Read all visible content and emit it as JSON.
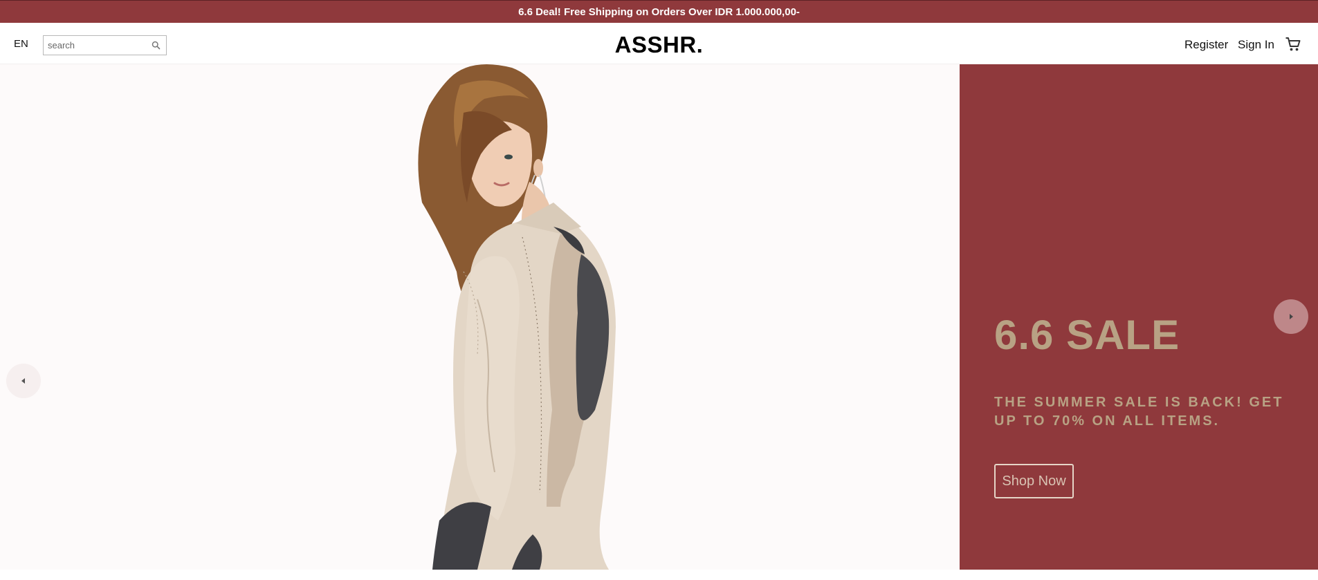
{
  "promo": {
    "text": "6.6 Deal! Free Shipping on Orders Over IDR 1.000.000,00-"
  },
  "header": {
    "language": "EN",
    "search_placeholder": "search",
    "logo": "ASSHR.",
    "register": "Register",
    "sign_in": "Sign In",
    "search_icon": "search-icon",
    "cart_icon": "cart-icon"
  },
  "hero": {
    "title": "6.6 SALE",
    "subtitle": "THE SUMMER SALE IS BACK! GET UP TO 70% ON ALL ITEMS.",
    "cta": "Shop Now",
    "prev_icon": "chevron-left-icon",
    "next_icon": "chevron-right-icon"
  },
  "colors": {
    "brand": "#8f393c",
    "sale_text": "#b8a284",
    "hero_bg": "#fdfafa"
  }
}
